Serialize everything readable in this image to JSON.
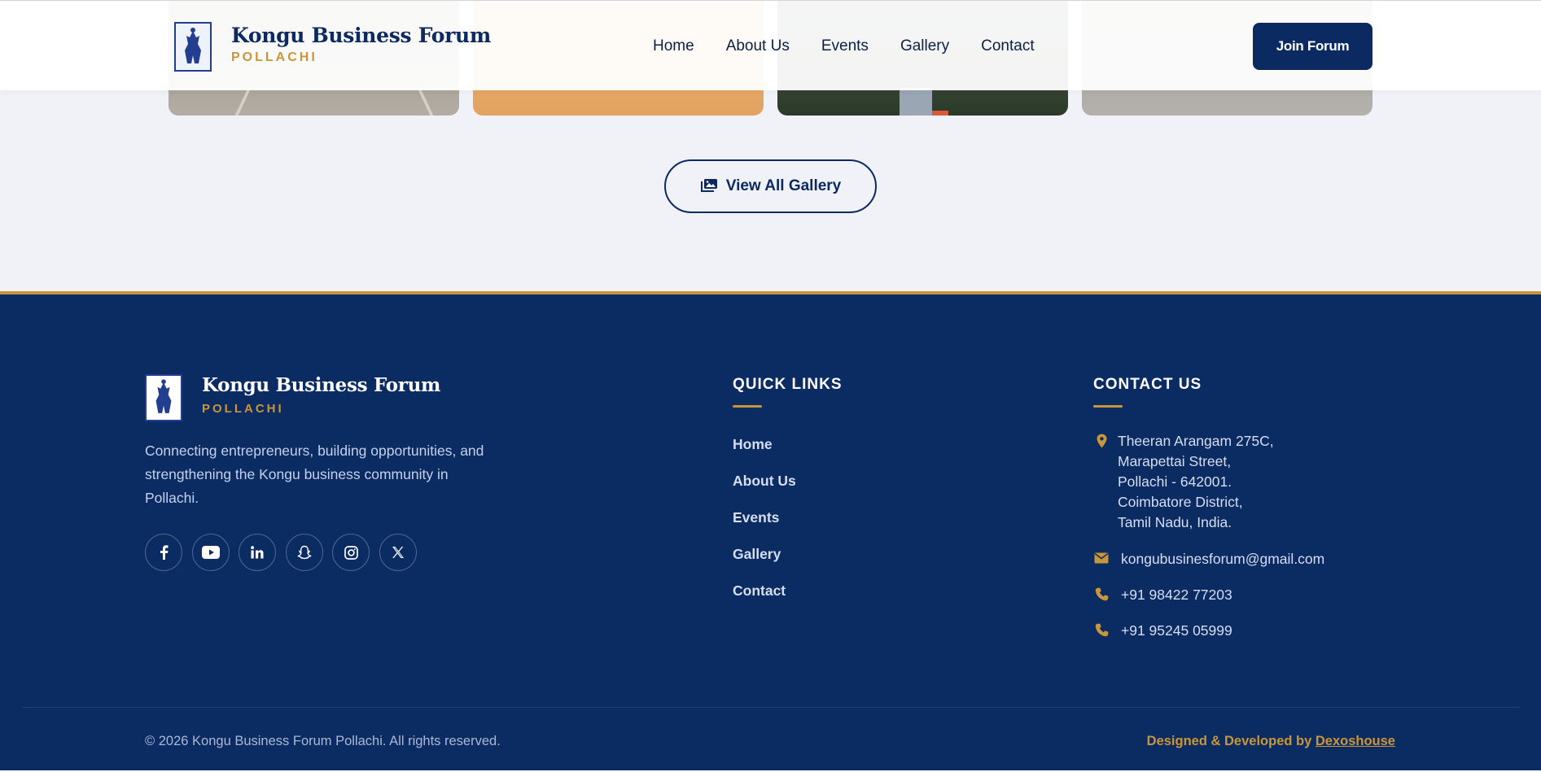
{
  "brand": {
    "title": "Kongu Business Forum",
    "subtitle": "POLLACHI"
  },
  "nav": {
    "links": [
      "Home",
      "About Us",
      "Events",
      "Gallery",
      "Contact"
    ],
    "join_label": "Join Forum"
  },
  "gallery": {
    "view_all_label": "View All Gallery"
  },
  "footer": {
    "brand_title": "Kongu Business Forum",
    "brand_subtitle": "POLLACHI",
    "description": "Connecting entrepreneurs, building opportunities, and strengthening the Kongu business community in Pollachi.",
    "socials": [
      "facebook-icon",
      "youtube-icon",
      "linkedin-icon",
      "snapchat-icon",
      "instagram-icon",
      "x-icon"
    ],
    "quick_links_title": "QUICK LINKS",
    "quick_links": [
      "Home",
      "About Us",
      "Events",
      "Gallery",
      "Contact"
    ],
    "contact_title": "CONTACT US",
    "address_lines": [
      "Theeran Arangam 275C,",
      "Marapettai Street,",
      "Pollachi - 642001.",
      "Coimbatore District,",
      "Tamil Nadu, India."
    ],
    "email": "kongubusinesforum@gmail.com",
    "phone_1": "+91 98422 77203",
    "phone_2": "+91 95245 05999",
    "copyright": "© 2026 Kongu Business Forum Pollachi. All rights reserved.",
    "credit_prefix": "Designed & Developed by ",
    "credit_link": "Dexoshouse"
  },
  "colors": {
    "navy": "#0b2b63",
    "gold": "#c9963a",
    "page_bg": "#f0f2f8"
  }
}
